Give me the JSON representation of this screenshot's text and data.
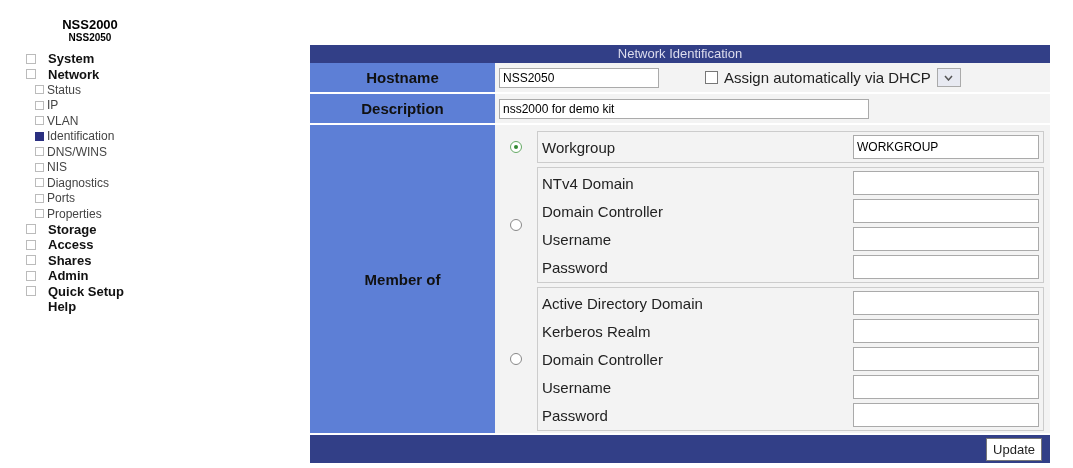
{
  "sidebar": {
    "title": "NSS2000",
    "subtitle": "NSS2050",
    "items": [
      {
        "label": "System",
        "selected": false
      },
      {
        "label": "Network",
        "selected": false,
        "children": [
          {
            "label": "Status",
            "selected": false
          },
          {
            "label": "IP",
            "selected": false
          },
          {
            "label": "VLAN",
            "selected": false
          },
          {
            "label": "Identification",
            "selected": true
          },
          {
            "label": "DNS/WINS",
            "selected": false
          },
          {
            "label": "NIS",
            "selected": false
          },
          {
            "label": "Diagnostics",
            "selected": false
          },
          {
            "label": "Ports",
            "selected": false
          },
          {
            "label": "Properties",
            "selected": false
          }
        ]
      },
      {
        "label": "Storage",
        "selected": false
      },
      {
        "label": "Access",
        "selected": false
      },
      {
        "label": "Shares",
        "selected": false
      },
      {
        "label": "Admin",
        "selected": false
      },
      {
        "label": "Quick Setup",
        "selected": false
      },
      {
        "label": "Help",
        "selected": false,
        "icon": false
      }
    ]
  },
  "panel": {
    "title": "Network Identification",
    "hostname": {
      "label": "Hostname",
      "value": "NSS2050"
    },
    "dhcp": {
      "label": "Assign automatically via DHCP",
      "checked": false
    },
    "description": {
      "label": "Description",
      "value": "nss2000 for demo kit"
    },
    "member_label": "Member of",
    "groups": [
      {
        "selected": true,
        "fields": [
          {
            "label": "Workgroup",
            "value": "WORKGROUP"
          }
        ]
      },
      {
        "selected": false,
        "fields": [
          {
            "label": "NTv4 Domain"
          },
          {
            "label": "Domain Controller"
          },
          {
            "label": "Username"
          },
          {
            "label": "Password"
          }
        ]
      },
      {
        "selected": false,
        "fields": [
          {
            "label": "Active Directory Domain"
          },
          {
            "label": "Kerberos Realm"
          },
          {
            "label": "Domain Controller"
          },
          {
            "label": "Username"
          },
          {
            "label": "Password"
          }
        ]
      }
    ],
    "button": "Update"
  }
}
